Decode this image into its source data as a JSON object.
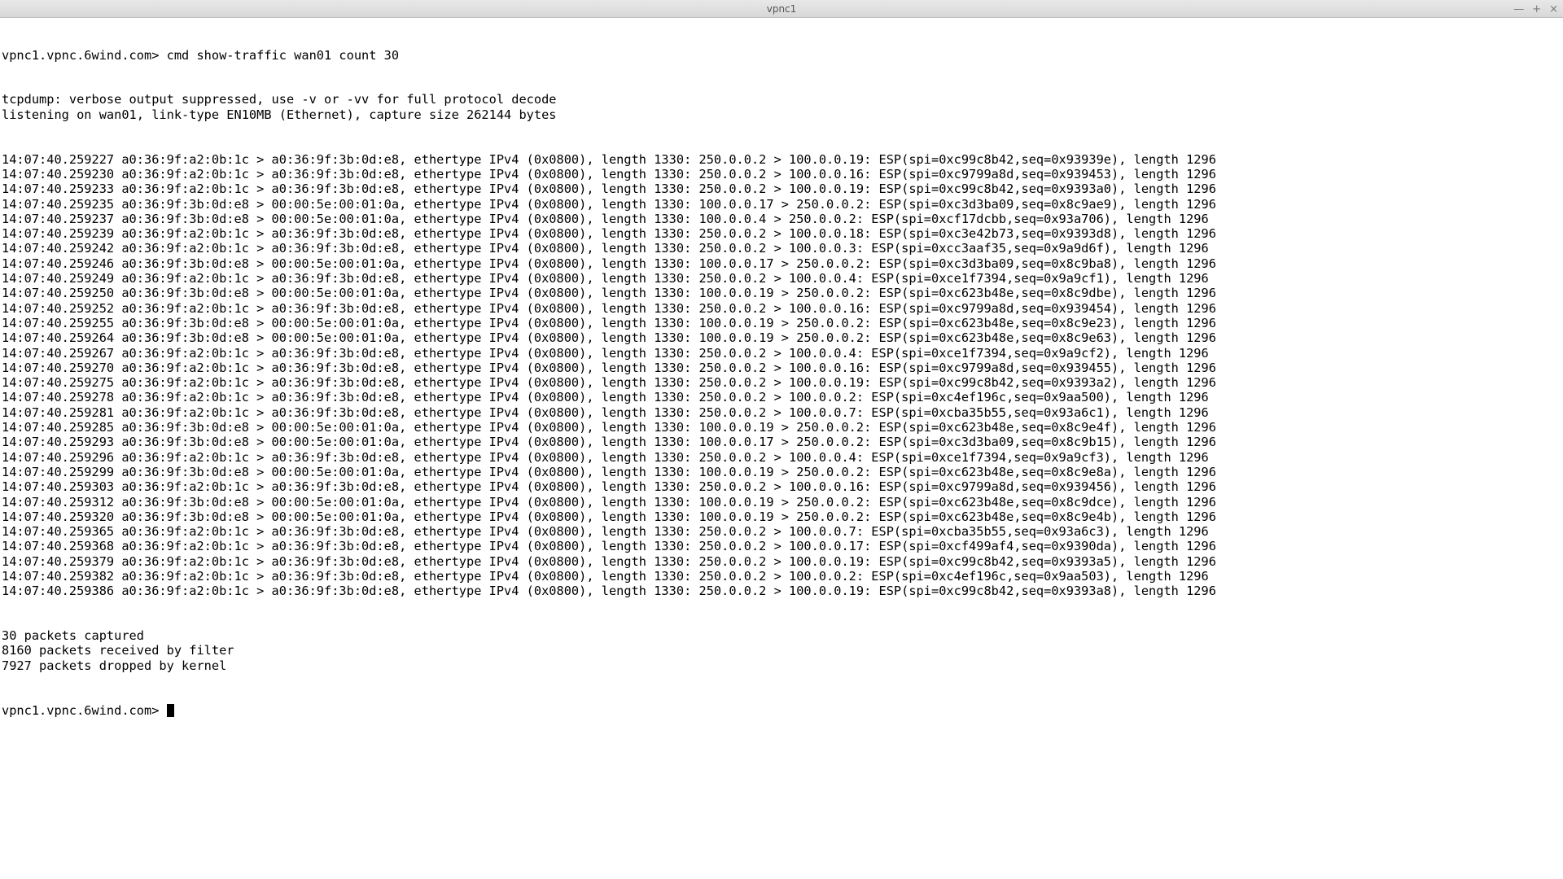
{
  "window": {
    "title": "vpnc1"
  },
  "terminal": {
    "prompt": "vpnc1.vpnc.6wind.com> ",
    "command": "cmd show-traffic wan01 count 30",
    "header_lines": [
      "tcpdump: verbose output suppressed, use -v or -vv for full protocol decode",
      "listening on wan01, link-type EN10MB (Ethernet), capture size 262144 bytes"
    ],
    "packets": [
      "14:07:40.259227 a0:36:9f:a2:0b:1c > a0:36:9f:3b:0d:e8, ethertype IPv4 (0x0800), length 1330: 250.0.0.2 > 100.0.0.19: ESP(spi=0xc99c8b42,seq=0x93939e), length 1296",
      "14:07:40.259230 a0:36:9f:a2:0b:1c > a0:36:9f:3b:0d:e8, ethertype IPv4 (0x0800), length 1330: 250.0.0.2 > 100.0.0.16: ESP(spi=0xc9799a8d,seq=0x939453), length 1296",
      "14:07:40.259233 a0:36:9f:a2:0b:1c > a0:36:9f:3b:0d:e8, ethertype IPv4 (0x0800), length 1330: 250.0.0.2 > 100.0.0.19: ESP(spi=0xc99c8b42,seq=0x9393a0), length 1296",
      "14:07:40.259235 a0:36:9f:3b:0d:e8 > 00:00:5e:00:01:0a, ethertype IPv4 (0x0800), length 1330: 100.0.0.17 > 250.0.0.2: ESP(spi=0xc3d3ba09,seq=0x8c9ae9), length 1296",
      "14:07:40.259237 a0:36:9f:3b:0d:e8 > 00:00:5e:00:01:0a, ethertype IPv4 (0x0800), length 1330: 100.0.0.4 > 250.0.0.2: ESP(spi=0xcf17dcbb,seq=0x93a706), length 1296",
      "14:07:40.259239 a0:36:9f:a2:0b:1c > a0:36:9f:3b:0d:e8, ethertype IPv4 (0x0800), length 1330: 250.0.0.2 > 100.0.0.18: ESP(spi=0xc3e42b73,seq=0x9393d8), length 1296",
      "14:07:40.259242 a0:36:9f:a2:0b:1c > a0:36:9f:3b:0d:e8, ethertype IPv4 (0x0800), length 1330: 250.0.0.2 > 100.0.0.3: ESP(spi=0xcc3aaf35,seq=0x9a9d6f), length 1296",
      "14:07:40.259246 a0:36:9f:3b:0d:e8 > 00:00:5e:00:01:0a, ethertype IPv4 (0x0800), length 1330: 100.0.0.17 > 250.0.0.2: ESP(spi=0xc3d3ba09,seq=0x8c9ba8), length 1296",
      "14:07:40.259249 a0:36:9f:a2:0b:1c > a0:36:9f:3b:0d:e8, ethertype IPv4 (0x0800), length 1330: 250.0.0.2 > 100.0.0.4: ESP(spi=0xce1f7394,seq=0x9a9cf1), length 1296",
      "14:07:40.259250 a0:36:9f:3b:0d:e8 > 00:00:5e:00:01:0a, ethertype IPv4 (0x0800), length 1330: 100.0.0.19 > 250.0.0.2: ESP(spi=0xc623b48e,seq=0x8c9dbe), length 1296",
      "14:07:40.259252 a0:36:9f:a2:0b:1c > a0:36:9f:3b:0d:e8, ethertype IPv4 (0x0800), length 1330: 250.0.0.2 > 100.0.0.16: ESP(spi=0xc9799a8d,seq=0x939454), length 1296",
      "14:07:40.259255 a0:36:9f:3b:0d:e8 > 00:00:5e:00:01:0a, ethertype IPv4 (0x0800), length 1330: 100.0.0.19 > 250.0.0.2: ESP(spi=0xc623b48e,seq=0x8c9e23), length 1296",
      "14:07:40.259264 a0:36:9f:3b:0d:e8 > 00:00:5e:00:01:0a, ethertype IPv4 (0x0800), length 1330: 100.0.0.19 > 250.0.0.2: ESP(spi=0xc623b48e,seq=0x8c9e63), length 1296",
      "14:07:40.259267 a0:36:9f:a2:0b:1c > a0:36:9f:3b:0d:e8, ethertype IPv4 (0x0800), length 1330: 250.0.0.2 > 100.0.0.4: ESP(spi=0xce1f7394,seq=0x9a9cf2), length 1296",
      "14:07:40.259270 a0:36:9f:a2:0b:1c > a0:36:9f:3b:0d:e8, ethertype IPv4 (0x0800), length 1330: 250.0.0.2 > 100.0.0.16: ESP(spi=0xc9799a8d,seq=0x939455), length 1296",
      "14:07:40.259275 a0:36:9f:a2:0b:1c > a0:36:9f:3b:0d:e8, ethertype IPv4 (0x0800), length 1330: 250.0.0.2 > 100.0.0.19: ESP(spi=0xc99c8b42,seq=0x9393a2), length 1296",
      "14:07:40.259278 a0:36:9f:a2:0b:1c > a0:36:9f:3b:0d:e8, ethertype IPv4 (0x0800), length 1330: 250.0.0.2 > 100.0.0.2: ESP(spi=0xc4ef196c,seq=0x9aa500), length 1296",
      "14:07:40.259281 a0:36:9f:a2:0b:1c > a0:36:9f:3b:0d:e8, ethertype IPv4 (0x0800), length 1330: 250.0.0.2 > 100.0.0.7: ESP(spi=0xcba35b55,seq=0x93a6c1), length 1296",
      "14:07:40.259285 a0:36:9f:3b:0d:e8 > 00:00:5e:00:01:0a, ethertype IPv4 (0x0800), length 1330: 100.0.0.19 > 250.0.0.2: ESP(spi=0xc623b48e,seq=0x8c9e4f), length 1296",
      "14:07:40.259293 a0:36:9f:3b:0d:e8 > 00:00:5e:00:01:0a, ethertype IPv4 (0x0800), length 1330: 100.0.0.17 > 250.0.0.2: ESP(spi=0xc3d3ba09,seq=0x8c9b15), length 1296",
      "14:07:40.259296 a0:36:9f:a2:0b:1c > a0:36:9f:3b:0d:e8, ethertype IPv4 (0x0800), length 1330: 250.0.0.2 > 100.0.0.4: ESP(spi=0xce1f7394,seq=0x9a9cf3), length 1296",
      "14:07:40.259299 a0:36:9f:3b:0d:e8 > 00:00:5e:00:01:0a, ethertype IPv4 (0x0800), length 1330: 100.0.0.19 > 250.0.0.2: ESP(spi=0xc623b48e,seq=0x8c9e8a), length 1296",
      "14:07:40.259303 a0:36:9f:a2:0b:1c > a0:36:9f:3b:0d:e8, ethertype IPv4 (0x0800), length 1330: 250.0.0.2 > 100.0.0.16: ESP(spi=0xc9799a8d,seq=0x939456), length 1296",
      "14:07:40.259312 a0:36:9f:3b:0d:e8 > 00:00:5e:00:01:0a, ethertype IPv4 (0x0800), length 1330: 100.0.0.19 > 250.0.0.2: ESP(spi=0xc623b48e,seq=0x8c9dce), length 1296",
      "14:07:40.259320 a0:36:9f:3b:0d:e8 > 00:00:5e:00:01:0a, ethertype IPv4 (0x0800), length 1330: 100.0.0.19 > 250.0.0.2: ESP(spi=0xc623b48e,seq=0x8c9e4b), length 1296",
      "14:07:40.259365 a0:36:9f:a2:0b:1c > a0:36:9f:3b:0d:e8, ethertype IPv4 (0x0800), length 1330: 250.0.0.2 > 100.0.0.7: ESP(spi=0xcba35b55,seq=0x93a6c3), length 1296",
      "14:07:40.259368 a0:36:9f:a2:0b:1c > a0:36:9f:3b:0d:e8, ethertype IPv4 (0x0800), length 1330: 250.0.0.2 > 100.0.0.17: ESP(spi=0xcf499af4,seq=0x9390da), length 1296",
      "14:07:40.259379 a0:36:9f:a2:0b:1c > a0:36:9f:3b:0d:e8, ethertype IPv4 (0x0800), length 1330: 250.0.0.2 > 100.0.0.19: ESP(spi=0xc99c8b42,seq=0x9393a5), length 1296",
      "14:07:40.259382 a0:36:9f:a2:0b:1c > a0:36:9f:3b:0d:e8, ethertype IPv4 (0x0800), length 1330: 250.0.0.2 > 100.0.0.2: ESP(spi=0xc4ef196c,seq=0x9aa503), length 1296",
      "14:07:40.259386 a0:36:9f:a2:0b:1c > a0:36:9f:3b:0d:e8, ethertype IPv4 (0x0800), length 1330: 250.0.0.2 > 100.0.0.19: ESP(spi=0xc99c8b42,seq=0x9393a8), length 1296"
    ],
    "footer_lines": [
      "30 packets captured",
      "8160 packets received by filter",
      "7927 packets dropped by kernel"
    ]
  }
}
